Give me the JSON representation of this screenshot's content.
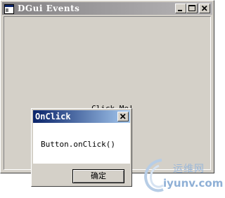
{
  "main_window": {
    "title": "DGui Events",
    "label_text": "Click Me!"
  },
  "icons": {
    "app": "app-window-icon",
    "minimize": "minimize-icon",
    "maximize": "maximize-icon",
    "close": "close-icon"
  },
  "dialog": {
    "title": "OnClick",
    "message": "Button.onClick()",
    "ok_label": "确定"
  },
  "watermark": {
    "cn_text": "运维网",
    "url_text": "iyunv.com"
  },
  "colors": {
    "window_face": "#d4d0c8",
    "inactive_titlebar": "#848284",
    "active_titlebar": "#0a246a",
    "watermark": "#8fb0d6"
  }
}
